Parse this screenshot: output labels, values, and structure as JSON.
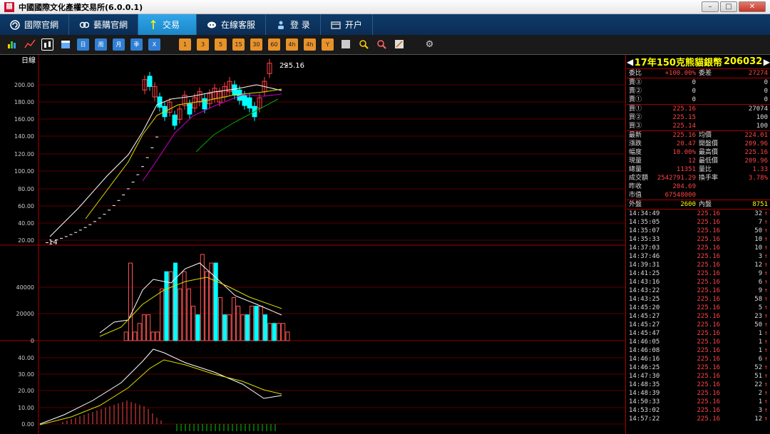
{
  "window": {
    "title": "中國國際文化產權交易所(6.0.0.1)",
    "icon": "app-logo-icon"
  },
  "nav": [
    {
      "label": "國際官網",
      "icon": "globe-icon",
      "active": false
    },
    {
      "label": "藝購官網",
      "icon": "link-icon",
      "active": false
    },
    {
      "label": "交易",
      "icon": "exchange-icon",
      "active": true
    },
    {
      "label": "在線客服",
      "icon": "support-icon",
      "active": false
    },
    {
      "label": "登  录",
      "icon": "login-icon",
      "active": false
    },
    {
      "label": "开户",
      "icon": "account-icon",
      "active": false
    }
  ],
  "toolbar": {
    "periods": [
      "日",
      "周",
      "月",
      "季",
      "X"
    ],
    "minutes": [
      "1",
      "3",
      "5",
      "15",
      "30",
      "60",
      "4h",
      "4h",
      "Y"
    ],
    "extra_icons": [
      "zoom-in-icon",
      "zoom-out-icon",
      "draw-icon",
      "settings-icon"
    ]
  },
  "chart": {
    "period_label": "日線",
    "last_price_label": "225.16",
    "low_label": "14",
    "price_axis": [
      "200.00",
      "180.00",
      "160.00",
      "140.00",
      "120.00",
      "100.00",
      "80.00",
      "60.00",
      "40.00",
      "20.00"
    ],
    "volume_axis": [
      "40000",
      "20000",
      "0"
    ],
    "indicator_axis": [
      "40.00",
      "30.00",
      "20.00",
      "10.00",
      "0.00"
    ]
  },
  "panel": {
    "title": "17年150克熊貓銀幣",
    "code": "206032",
    "ratio": {
      "label1": "委比",
      "value1": "+100.00%",
      "label2": "委差",
      "value2": "27274"
    },
    "asks": [
      {
        "label": "賣③",
        "price": "0",
        "qty": "0"
      },
      {
        "label": "賣②",
        "price": "0",
        "qty": "0"
      },
      {
        "label": "賣①",
        "price": "0",
        "qty": "0"
      }
    ],
    "bids": [
      {
        "label": "買①",
        "price": "225.16",
        "qty": "27074"
      },
      {
        "label": "買②",
        "price": "225.15",
        "qty": "100"
      },
      {
        "label": "買③",
        "price": "225.14",
        "qty": "100"
      }
    ],
    "stats": [
      {
        "l1": "最新",
        "v1": "225.16",
        "l2": "均價",
        "v2": "224.01"
      },
      {
        "l1": "漲跌",
        "v1": "20.47",
        "l2": "開盤價",
        "v2": "209.96"
      },
      {
        "l1": "幅度",
        "v1": "10.00%",
        "l2": "最高價",
        "v2": "225.16"
      },
      {
        "l1": "現量",
        "v1": "12",
        "l2": "最低價",
        "v2": "209.96"
      },
      {
        "l1": "總量",
        "v1": "11351",
        "l2": "量比",
        "v2": "1.33"
      },
      {
        "l1": "成交額",
        "v1": "2542791.29",
        "l2": "換手率",
        "v2": "3.78%"
      },
      {
        "l1": "昨收",
        "v1": "204.69",
        "l2": "",
        "v2": ""
      },
      {
        "l1": "市值",
        "v1": "67548000",
        "l2": "",
        "v2": ""
      }
    ],
    "outer_inner": {
      "l1": "外盤",
      "v1": "2600",
      "l2": "內盤",
      "v2": "8751"
    },
    "ticks": [
      {
        "time": "14:34:49",
        "price": "225.16",
        "vol": "32"
      },
      {
        "time": "14:35:05",
        "price": "225.16",
        "vol": "7"
      },
      {
        "time": "14:35:07",
        "price": "225.16",
        "vol": "50"
      },
      {
        "time": "14:35:33",
        "price": "225.16",
        "vol": "10"
      },
      {
        "time": "14:37:03",
        "price": "225.16",
        "vol": "10"
      },
      {
        "time": "14:37:46",
        "price": "225.16",
        "vol": "3"
      },
      {
        "time": "14:39:31",
        "price": "225.16",
        "vol": "12"
      },
      {
        "time": "14:41:25",
        "price": "225.16",
        "vol": "9"
      },
      {
        "time": "14:43:16",
        "price": "225.16",
        "vol": "6"
      },
      {
        "time": "14:43:22",
        "price": "225.16",
        "vol": "9"
      },
      {
        "time": "14:43:25",
        "price": "225.16",
        "vol": "58"
      },
      {
        "time": "14:45:20",
        "price": "225.16",
        "vol": "5"
      },
      {
        "time": "14:45:27",
        "price": "225.16",
        "vol": "23"
      },
      {
        "time": "14:45:27",
        "price": "225.16",
        "vol": "50"
      },
      {
        "time": "14:45:47",
        "price": "225.16",
        "vol": "1"
      },
      {
        "time": "14:46:05",
        "price": "225.16",
        "vol": "1"
      },
      {
        "time": "14:46:08",
        "price": "225.16",
        "vol": "1"
      },
      {
        "time": "14:46:16",
        "price": "225.16",
        "vol": "6"
      },
      {
        "time": "14:46:25",
        "price": "225.16",
        "vol": "52"
      },
      {
        "time": "14:47:30",
        "price": "225.16",
        "vol": "51"
      },
      {
        "time": "14:48:35",
        "price": "225.16",
        "vol": "22"
      },
      {
        "time": "14:48:39",
        "price": "225.16",
        "vol": "2"
      },
      {
        "time": "14:50:33",
        "price": "225.16",
        "vol": "1"
      },
      {
        "time": "14:53:02",
        "price": "225.16",
        "vol": "3"
      },
      {
        "time": "14:57:22",
        "price": "225.16",
        "vol": "12"
      }
    ],
    "arrow": "↑"
  }
}
